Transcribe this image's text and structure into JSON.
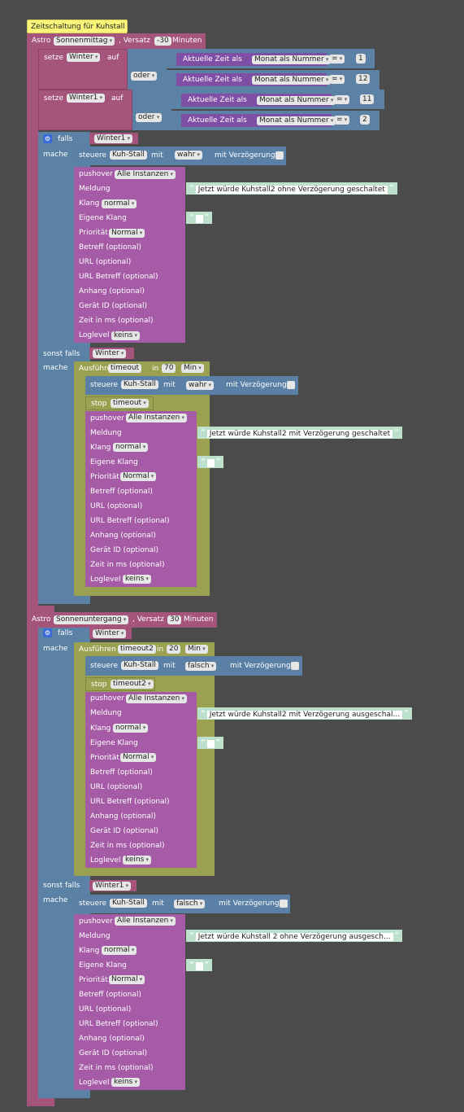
{
  "comment_label": "Zeitschaltung für Kuhstall",
  "astro1": {
    "astro_label": "Astro",
    "event": "Sonnenmittag",
    "offset_label": ", Versatz",
    "offset": "-30",
    "unit_label": "Minuten"
  },
  "setze_winter": {
    "setze_label": "setze",
    "var": "Winter",
    "auf_label": "auf",
    "oder_label": "oder",
    "rows": [
      {
        "time_label": "Aktuelle Zeit als",
        "format": "Monat als Nummer",
        "op": "=",
        "value": "1"
      },
      {
        "time_label": "Aktuelle Zeit als",
        "format": "Monat als Nummer",
        "op": "=",
        "value": "12"
      }
    ]
  },
  "setze_winter1": {
    "setze_label": "setze",
    "var": "Winter1",
    "auf_label": "auf",
    "oder_label": "oder",
    "rows": [
      {
        "time_label": "Aktuelle Zeit als",
        "format": "Monat als Nummer",
        "op": "=",
        "value": "11"
      },
      {
        "time_label": "Aktuelle Zeit als",
        "format": "Monat als Nummer",
        "op": "=",
        "value": "2"
      }
    ]
  },
  "if1": {
    "falls_label": "falls",
    "cond1": "Winter1",
    "mache_label": "mache",
    "sonst_falls_label": "sonst falls",
    "cond2": "Winter"
  },
  "steuere1": {
    "steuere_label": "steuere",
    "device": "Kuh-Stall",
    "mit_label": "mit",
    "value": "wahr",
    "delay_label": "mit Verzögerung"
  },
  "steuere2": {
    "steuere_label": "steuere",
    "device": "Kuh-Stall",
    "mit_label": "mit",
    "value": "wahr",
    "delay_label": "mit Verzögerung"
  },
  "timeout1": {
    "exec_label": "Ausführen",
    "name": "timeout",
    "in_label": "in",
    "value": "70",
    "unit": "Min",
    "stop_label": "stop",
    "stop_name": "timeout"
  },
  "astro2": {
    "astro_label": "Astro",
    "event": "Sonnenuntergang",
    "offset_label": ", Versatz",
    "offset": "30",
    "unit_label": "Minuten"
  },
  "if2": {
    "falls_label": "falls",
    "cond1": "Winter",
    "mache_label": "mache",
    "sonst_falls_label": "sonst falls",
    "cond2": "Winter1"
  },
  "timeout2": {
    "exec_label": "Ausführen",
    "name": "timeout2",
    "in_label": "in",
    "value": "20",
    "unit": "Min",
    "stop_label": "stop",
    "stop_name": "timeout2"
  },
  "steuere3": {
    "steuere_label": "steuere",
    "device": "Kuh-Stall",
    "mit_label": "mit",
    "value": "falsch",
    "delay_label": "mit Verzögerung"
  },
  "steuere4": {
    "steuere_label": "steuere",
    "device": "Kuh-Stall",
    "mit_label": "mit",
    "value": "falsch",
    "delay_label": "mit Verzögerung"
  },
  "pushover_labels": {
    "pushover": "pushover",
    "instances": "Alle Instanzen",
    "meldung": "Meldung",
    "klang": "Klang",
    "klang_value": "normal",
    "eigene_klang": "Eigene Klang",
    "prioritaet": "Priorität",
    "prioritaet_value": "Normal",
    "betreff": "Betreff (optional)",
    "url": "URL (optional)",
    "url_betreff": "URL Betreff (optional)",
    "anhang": "Anhang (optional)",
    "geraet": "Gerät ID (optional)",
    "zeit": "Zeit in ms (optional)",
    "loglevel": "Loglevel",
    "loglevel_value": "keins"
  },
  "messages": {
    "msg1": "Jetzt würde Kuhstall2 ohne Verzögerung geschaltet",
    "msg2": "Jetzt würde Kuhstall2 mit Verzögerung geschaltet",
    "msg3": "Jetzt würde Kuhstall2 mit Verzögerung ausgeschal...",
    "msg4": "Jetzt würde Kuhstall 2 ohne Verzögerung ausgesch..."
  },
  "colors": {
    "background": "#4b4b4b",
    "astro": "#a5557c",
    "logic": "#5b82a5",
    "pushover": "#a55ba5",
    "timeout": "#9aa251",
    "comment": "#fbf57a"
  }
}
